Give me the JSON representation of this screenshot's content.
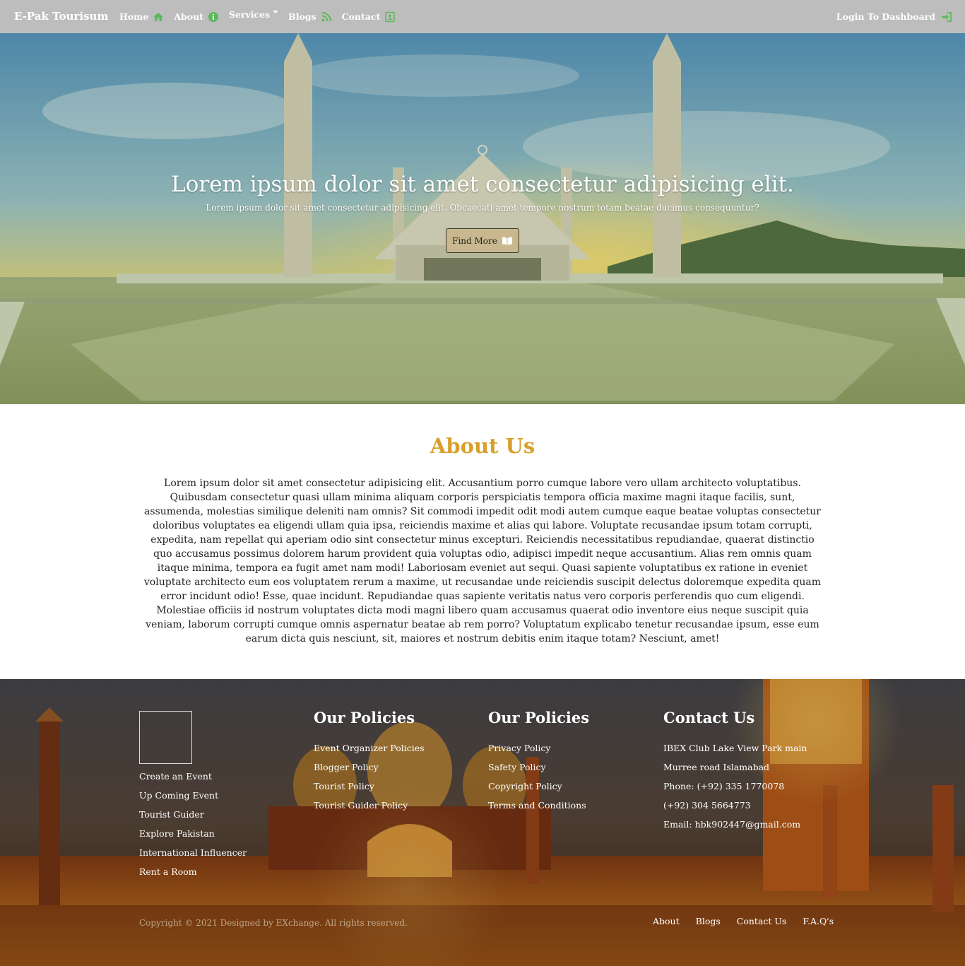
{
  "navbar": {
    "brand": "E-Pak Tourisum",
    "items": [
      {
        "label": "Home",
        "icon": "home-icon"
      },
      {
        "label": "About",
        "icon": "info-icon"
      },
      {
        "label": "Services",
        "icon": "chevron-down-icon"
      },
      {
        "label": "Blogs",
        "icon": "rss-icon"
      },
      {
        "label": "Contact",
        "icon": "contact-card-icon"
      }
    ],
    "login": "Login To Dashboard",
    "login_icon": "sign-in-icon",
    "icon_color": "#5cb85c"
  },
  "hero": {
    "title": "Lorem ipsum dolor sit amet consectetur adipisicing elit.",
    "subtitle": "Lorem ipsum dolor sit amet consectetur adipisicing elit. Obcaecati amet tempore nostrum totam beatae ducimus consequuntur?",
    "button": "Find More",
    "button_icon": "book-open-icon"
  },
  "about": {
    "title": "About Us",
    "title_color": "#d8a02a",
    "text": "Lorem ipsum dolor sit amet consectetur adipisicing elit. Accusantium porro cumque labore vero ullam architecto voluptatibus. Quibusdam consectetur quasi ullam minima aliquam corporis perspiciatis tempora officia maxime magni itaque facilis, sunt, assumenda, molestias similique deleniti nam omnis? Sit commodi impedit odit modi autem cumque eaque beatae voluptas consectetur doloribus voluptates ea eligendi ullam quia ipsa, reiciendis maxime et alias qui labore. Voluptate recusandae ipsum totam corrupti, expedita, nam repellat qui aperiam odio sint consectetur minus excepturi. Reiciendis necessitatibus repudiandae, quaerat distinctio quo accusamus possimus dolorem harum provident quia voluptas odio, adipisci impedit neque accusantium. Alias rem omnis quam itaque minima, tempora ea fugit amet nam modi! Laboriosam eveniet aut sequi. Quasi sapiente voluptatibus ex ratione in eveniet voluptate architecto eum eos voluptatem rerum a maxime, ut recusandae unde reiciendis suscipit delectus doloremque expedita quam error incidunt odio! Esse, quae incidunt. Repudiandae quas sapiente veritatis natus vero corporis perferendis quo cum eligendi. Molestiae officiis id nostrum voluptates dicta modi magni libero quam accusamus quaerat odio inventore eius neque suscipit quia veniam, laborum corrupti cumque omnis aspernatur beatae ab rem porro? Voluptatum explicabo tenetur recusandae ipsum, esse eum earum dicta quis nesciunt, sit, maiores et nostrum debitis enim itaque totam? Nesciunt, amet!"
  },
  "footer": {
    "col1": {
      "links": [
        "Create an Event",
        "Up Coming Event",
        "Tourist Guider",
        "Explore Pakistan",
        "International Influencer",
        "Rent a Room"
      ]
    },
    "col2": {
      "title": "Our Policies",
      "links": [
        "Event Organizer Policies",
        "Blogger Policy",
        "Tourist Policy",
        "Tourist Guider Policy"
      ]
    },
    "col3": {
      "title": "Our Policies",
      "links": [
        "Privacy Policy",
        "Safety Policy",
        "Copyright Policy",
        "Terms and Conditions"
      ]
    },
    "col4": {
      "title": "Contact Us",
      "lines": [
        "IBEX Club Lake View Park main",
        "Murree road Islamabad",
        "Phone: (+92) 335 1770078",
        "(+92) 304 5664773",
        "Email: hbk902447@gmail.com"
      ]
    },
    "copyright": "Copyright © 2021 Designed by EXchange. All rights reserved.",
    "bottom_links": [
      "About",
      "Blogs",
      "Contact Us",
      "F.A.Q's"
    ]
  }
}
